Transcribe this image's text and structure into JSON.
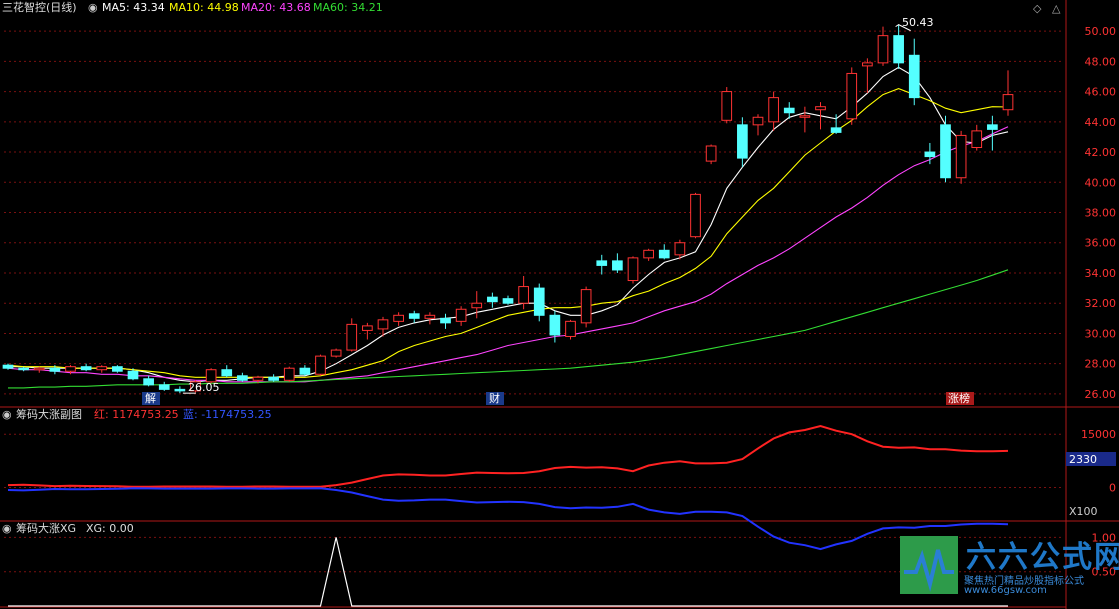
{
  "panel_main": {
    "title": "三花智控(日线)",
    "ma_legend": [
      {
        "label": "MA5: 43.34",
        "color": "#ffffff"
      },
      {
        "label": "MA10: 44.98",
        "color": "#ffff00"
      },
      {
        "label": "MA20: 43.68",
        "color": "#ff44ff"
      },
      {
        "label": "MA60: 34.21",
        "color": "#33dd33"
      }
    ],
    "high_marker": "50.43",
    "low_marker": "26.05",
    "event_tags": [
      "解",
      "财",
      "涨榜"
    ]
  },
  "panel_sub1": {
    "title": "筹码大涨副图",
    "red_label": "红: 1174753.25",
    "blue_label": "蓝: -1174753.25",
    "scale_badge": "2330",
    "multiplier_badge": "X100"
  },
  "panel_sub2": {
    "title": "筹码大涨XG",
    "xg_label": "XG: 0.00"
  },
  "brand": {
    "title": "六六公式网",
    "subtitle": "聚焦热门精品炒股指标公式",
    "url": "www.66gsw.com"
  },
  "chart_data": [
    {
      "type": "candlestick",
      "y_ticks": [
        26.0,
        28.0,
        30.0,
        32.0,
        34.0,
        36.0,
        38.0,
        40.0,
        42.0,
        44.0,
        46.0,
        48.0,
        50.0
      ],
      "ylim": [
        25.2,
        51.0
      ],
      "up_color": "#ff3333",
      "down_color": "#54ffff",
      "candles": [
        [
          27.9,
          28.0,
          27.6,
          27.7
        ],
        [
          27.7,
          27.8,
          27.5,
          27.6
        ],
        [
          27.6,
          27.8,
          27.4,
          27.7
        ],
        [
          27.7,
          27.9,
          27.3,
          27.5
        ],
        [
          27.5,
          27.9,
          27.3,
          27.8
        ],
        [
          27.8,
          28.0,
          27.5,
          27.6
        ],
        [
          27.6,
          27.9,
          27.4,
          27.8
        ],
        [
          27.8,
          27.9,
          27.4,
          27.5
        ],
        [
          27.5,
          27.7,
          26.9,
          27.0
        ],
        [
          27.0,
          27.2,
          26.5,
          26.6
        ],
        [
          26.6,
          26.8,
          26.2,
          26.3
        ],
        [
          26.3,
          26.5,
          26.05,
          26.2
        ],
        [
          26.2,
          26.9,
          26.1,
          26.8
        ],
        [
          26.8,
          27.7,
          26.7,
          27.6
        ],
        [
          27.6,
          27.9,
          27.1,
          27.2
        ],
        [
          27.2,
          27.4,
          26.8,
          26.9
        ],
        [
          26.9,
          27.2,
          26.7,
          27.1
        ],
        [
          27.1,
          27.3,
          26.8,
          26.9
        ],
        [
          26.9,
          27.8,
          26.8,
          27.7
        ],
        [
          27.7,
          27.9,
          27.2,
          27.3
        ],
        [
          27.3,
          28.6,
          27.2,
          28.5
        ],
        [
          28.5,
          29.0,
          28.4,
          28.9
        ],
        [
          28.9,
          31.0,
          28.8,
          30.6
        ],
        [
          30.2,
          30.7,
          29.6,
          30.5
        ],
        [
          30.3,
          31.1,
          29.8,
          30.9
        ],
        [
          30.8,
          31.4,
          30.5,
          31.2
        ],
        [
          31.3,
          31.5,
          30.7,
          31.0
        ],
        [
          31.0,
          31.4,
          30.6,
          31.2
        ],
        [
          31.0,
          31.3,
          30.3,
          30.7
        ],
        [
          30.8,
          31.8,
          30.5,
          31.6
        ],
        [
          31.7,
          32.8,
          31.0,
          32.0
        ],
        [
          32.4,
          32.7,
          31.7,
          32.1
        ],
        [
          32.3,
          32.5,
          31.9,
          32.0
        ],
        [
          32.0,
          33.8,
          31.6,
          33.1
        ],
        [
          33.0,
          33.3,
          30.8,
          31.2
        ],
        [
          31.2,
          31.5,
          29.4,
          29.9
        ],
        [
          29.8,
          30.9,
          29.6,
          30.8
        ],
        [
          30.7,
          33.1,
          30.4,
          32.9
        ],
        [
          34.8,
          35.2,
          33.9,
          34.5
        ],
        [
          34.8,
          35.3,
          34.0,
          34.2
        ],
        [
          33.5,
          35.1,
          33.3,
          35.0
        ],
        [
          35.0,
          35.6,
          34.8,
          35.5
        ],
        [
          35.5,
          35.9,
          34.9,
          35.0
        ],
        [
          35.2,
          36.2,
          34.9,
          36.0
        ],
        [
          36.4,
          39.3,
          36.3,
          39.2
        ],
        [
          41.4,
          42.5,
          41.2,
          42.4
        ],
        [
          44.1,
          46.3,
          43.9,
          46.0
        ],
        [
          43.8,
          44.3,
          41.0,
          41.6
        ],
        [
          43.8,
          44.5,
          43.1,
          44.3
        ],
        [
          44.0,
          46.0,
          43.4,
          45.6
        ],
        [
          44.9,
          45.3,
          44.2,
          44.6
        ],
        [
          44.3,
          45.0,
          43.3,
          44.4
        ],
        [
          44.8,
          45.3,
          43.5,
          45.0
        ],
        [
          43.6,
          44.5,
          43.2,
          43.3
        ],
        [
          44.2,
          47.6,
          43.8,
          47.2
        ],
        [
          47.7,
          48.2,
          45.9,
          47.9
        ],
        [
          47.9,
          50.3,
          47.7,
          49.7
        ],
        [
          49.7,
          50.43,
          47.5,
          47.9
        ],
        [
          48.4,
          49.5,
          45.1,
          45.6
        ],
        [
          42.0,
          42.6,
          41.2,
          41.7
        ],
        [
          43.8,
          44.4,
          40.0,
          40.3
        ],
        [
          40.3,
          43.4,
          39.9,
          43.1
        ],
        [
          42.3,
          43.8,
          42.1,
          43.4
        ],
        [
          43.8,
          44.4,
          42.1,
          43.5
        ],
        [
          44.8,
          47.4,
          44.4,
          45.8
        ]
      ],
      "ma_series": [
        {
          "values": [
            27.8,
            27.8,
            27.7,
            27.7,
            27.7,
            27.7,
            27.7,
            27.7,
            27.6,
            27.4,
            27.1,
            26.9,
            26.8,
            26.9,
            26.9,
            27.0,
            27.1,
            27.1,
            27.2,
            27.2,
            27.5,
            28.0,
            28.6,
            29.2,
            29.9,
            30.4,
            30.7,
            30.9,
            31.0,
            31.1,
            31.4,
            31.6,
            31.8,
            32.0,
            32.0,
            31.5,
            31.2,
            31.2,
            31.5,
            31.9,
            33.0,
            33.9,
            34.7,
            35.0,
            35.4,
            37.2,
            39.6,
            41.0,
            42.3,
            43.5,
            44.3,
            44.6,
            44.4,
            44.2,
            45.0,
            45.9,
            47.0,
            47.6,
            47.0,
            45.6,
            43.8,
            42.7,
            42.6,
            43.1,
            43.34
          ]
        },
        {
          "values": [
            27.9,
            27.8,
            27.8,
            27.8,
            27.7,
            27.7,
            27.7,
            27.7,
            27.6,
            27.5,
            27.4,
            27.2,
            27.1,
            27.1,
            27.1,
            27.1,
            27.1,
            27.1,
            27.1,
            27.1,
            27.2,
            27.4,
            27.6,
            27.9,
            28.2,
            28.8,
            29.2,
            29.5,
            29.8,
            30.0,
            30.4,
            30.8,
            31.2,
            31.4,
            31.6,
            31.7,
            31.7,
            31.8,
            32.0,
            32.1,
            32.5,
            32.8,
            33.3,
            33.7,
            34.3,
            35.1,
            36.6,
            37.7,
            38.8,
            39.6,
            40.7,
            41.8,
            42.6,
            43.4,
            44.1,
            45.0,
            45.8,
            46.2,
            45.8,
            45.4,
            44.9,
            44.6,
            44.8,
            45.0,
            44.98
          ]
        },
        {
          "values": [
            27.7,
            27.6,
            27.6,
            27.5,
            27.4,
            27.4,
            27.3,
            27.3,
            27.2,
            27.2,
            27.1,
            27.0,
            26.9,
            26.9,
            26.8,
            26.8,
            26.8,
            26.8,
            26.8,
            26.8,
            26.9,
            27.0,
            27.1,
            27.2,
            27.4,
            27.6,
            27.8,
            28.0,
            28.2,
            28.4,
            28.6,
            28.9,
            29.2,
            29.4,
            29.6,
            29.8,
            29.9,
            30.1,
            30.3,
            30.5,
            30.7,
            31.1,
            31.5,
            31.8,
            32.1,
            32.6,
            33.3,
            33.9,
            34.5,
            35.0,
            35.6,
            36.3,
            37.0,
            37.7,
            38.3,
            39.0,
            39.8,
            40.5,
            41.1,
            41.5,
            42.0,
            42.4,
            42.7,
            43.2,
            43.68
          ]
        },
        {
          "values": [
            26.4,
            26.4,
            26.45,
            26.45,
            26.5,
            26.5,
            26.55,
            26.6,
            26.6,
            26.6,
            26.6,
            26.65,
            26.65,
            26.7,
            26.7,
            26.7,
            26.75,
            26.8,
            26.8,
            26.85,
            26.9,
            26.95,
            27.0,
            27.05,
            27.1,
            27.15,
            27.2,
            27.25,
            27.3,
            27.35,
            27.4,
            27.45,
            27.5,
            27.55,
            27.6,
            27.65,
            27.7,
            27.8,
            27.9,
            28.0,
            28.1,
            28.25,
            28.4,
            28.6,
            28.8,
            29.0,
            29.2,
            29.4,
            29.6,
            29.8,
            30.0,
            30.2,
            30.5,
            30.8,
            31.1,
            31.4,
            31.7,
            32.0,
            32.3,
            32.6,
            32.9,
            33.2,
            33.5,
            33.85,
            34.21
          ]
        }
      ]
    },
    {
      "type": "line",
      "y_ticks": [
        15000,
        0
      ],
      "ylim": [
        -8000,
        19000
      ],
      "series": [
        {
          "name": "红",
          "color": "#ff2222",
          "values": [
            700,
            800,
            600,
            400,
            500,
            450,
            400,
            350,
            200,
            250,
            300,
            300,
            300,
            300,
            250,
            250,
            300,
            300,
            250,
            250,
            200,
            700,
            1400,
            2400,
            3400,
            3700,
            3600,
            3400,
            3400,
            3800,
            4200,
            4100,
            4000,
            4100,
            4600,
            5500,
            5800,
            5600,
            5700,
            5400,
            4600,
            6200,
            7000,
            7400,
            6800,
            6800,
            7000,
            8000,
            11000,
            13800,
            15500,
            16200,
            17300,
            16000,
            15000,
            13000,
            11500,
            11200,
            11300,
            10800,
            10800,
            10400,
            10200,
            10200,
            10300
          ]
        },
        {
          "name": "蓝",
          "color": "#2233ff",
          "values": [
            -700,
            -800,
            -600,
            -400,
            -500,
            -450,
            -400,
            -350,
            -200,
            -250,
            -300,
            -300,
            -300,
            -300,
            -250,
            -250,
            -300,
            -300,
            -250,
            -250,
            -200,
            -700,
            -1400,
            -2400,
            -3400,
            -3700,
            -3600,
            -3400,
            -3400,
            -3800,
            -4200,
            -4100,
            -4000,
            -4100,
            -4600,
            -5500,
            -5800,
            -5600,
            -5700,
            -5400,
            -4600,
            -6200,
            -7000,
            -7400,
            -6800,
            -6800,
            -7000,
            -8000,
            -11000,
            -13800,
            -15500,
            -16200,
            -17300,
            -16000,
            -15000,
            -13000,
            -11500,
            -11200,
            -11300,
            -10800,
            -10800,
            -10400,
            -10200,
            -10200,
            -10300
          ]
        }
      ]
    },
    {
      "type": "line",
      "y_ticks": [
        1.0,
        0.5
      ],
      "ylim": [
        0,
        1.05
      ],
      "series": [
        {
          "color": "#ffffff",
          "values": [
            0,
            0,
            0,
            0,
            0,
            0,
            0,
            0,
            0,
            0,
            0,
            0,
            0,
            0,
            0,
            0,
            0,
            0,
            0,
            0,
            0,
            0,
            0,
            0,
            0,
            0,
            0,
            0,
            0,
            0,
            0,
            0,
            0,
            0,
            0,
            0,
            0,
            0,
            0,
            0,
            0,
            0,
            0,
            0,
            0,
            0,
            0,
            0,
            0,
            0,
            0,
            0,
            0,
            0,
            0,
            0,
            0,
            0,
            0,
            0,
            0,
            0,
            0,
            0,
            0
          ]
        }
      ],
      "spike": {
        "index": 21,
        "value": 1.0
      }
    }
  ]
}
